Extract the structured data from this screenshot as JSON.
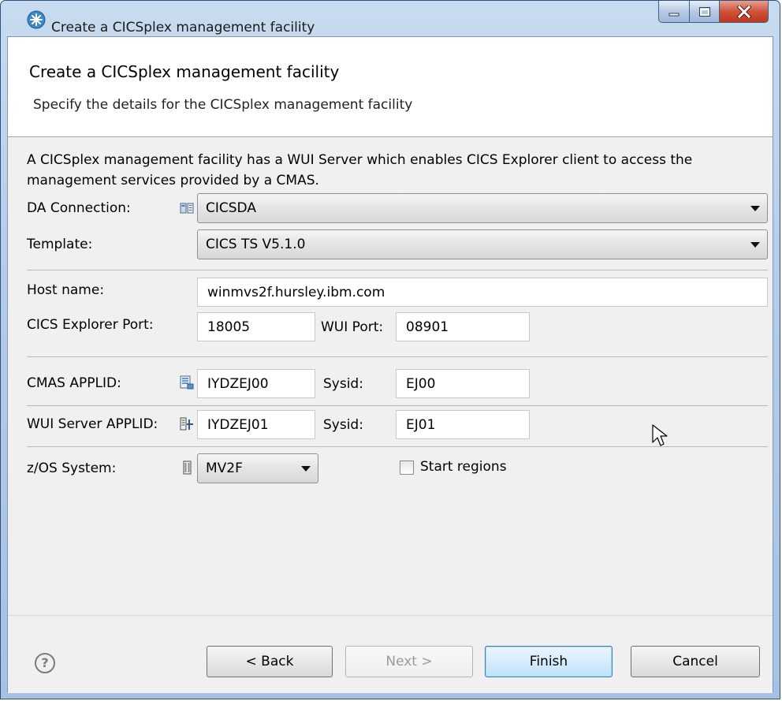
{
  "window": {
    "title": "Create a CICSplex management facility",
    "icon": "eclipse-wizard-icon"
  },
  "banner": {
    "title": "Create a CICSplex management facility",
    "description": "Specify the details for the CICSplex management facility"
  },
  "info_text": "A CICSplex management facility has a WUI Server which enables CICS Explorer client to access the management services provided by a CMAS.",
  "form": {
    "da_connection": {
      "label": "DA Connection:",
      "value": "CICSDA",
      "icon": "connection-icon"
    },
    "template": {
      "label": "Template:",
      "value": "CICS TS V5.1.0"
    },
    "host_name": {
      "label": "Host name:",
      "value": "winmvs2f.hursley.ibm.com"
    },
    "explorer_port": {
      "label": "CICS Explorer Port:",
      "value": "18005"
    },
    "wui_port": {
      "label": "WUI Port:",
      "value": "08901"
    },
    "cmas_applid": {
      "label": "CMAS APPLID:",
      "value": "IYDZEJ00",
      "icon": "cmas-icon"
    },
    "cmas_sysid": {
      "label": "Sysid:",
      "value": "EJ00"
    },
    "wui_applid": {
      "label": "WUI Server APPLID:",
      "value": "IYDZEJ01",
      "icon": "wui-server-icon"
    },
    "wui_sysid": {
      "label": "Sysid:",
      "value": "EJ01"
    },
    "zos_system": {
      "label": "z/OS System:",
      "value": "MV2F",
      "icon": "zos-system-icon"
    },
    "start_regions": {
      "label": "Start regions",
      "checked": false
    }
  },
  "buttons": {
    "help": "?",
    "back": "< Back",
    "next": "Next >",
    "finish": "Finish",
    "cancel": "Cancel"
  },
  "colors": {
    "title_frame": "#b4cce8",
    "close_button": "#c1351a",
    "default_button": "#3c7fb1"
  }
}
